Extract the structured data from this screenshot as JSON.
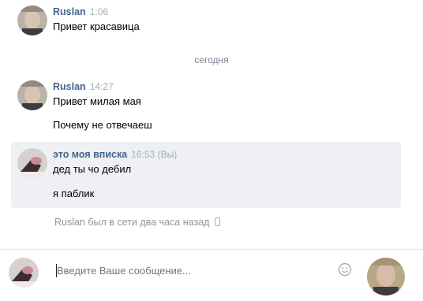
{
  "messages": [
    {
      "author": "Ruslan",
      "time": "1:06",
      "lines": [
        "Привет красавица"
      ]
    }
  ],
  "date_separator": "сегодня",
  "group2": {
    "author": "Ruslan",
    "time": "14:27",
    "lines": [
      "Привет милая мая",
      "Почему не отвечаеш"
    ]
  },
  "group3": {
    "author": "это моя вписка",
    "time": "16:53 (Вы)",
    "lines": [
      "дед ты чо дебил",
      "я паблик"
    ]
  },
  "status": {
    "text": "Ruslan был в сети два часа назад",
    "icon": "phone-icon"
  },
  "composer": {
    "placeholder": "Введите Ваше сообщение...",
    "emoji_icon": "smile-icon"
  },
  "colors": {
    "author": "#42648b",
    "time": "#a3adba",
    "highlight_bg": "#eef0f3"
  }
}
